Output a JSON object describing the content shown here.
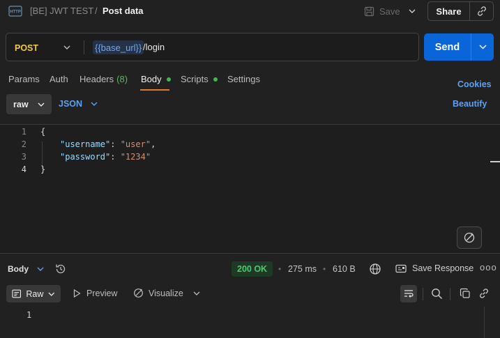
{
  "header": {
    "collection": "[BE] JWT TEST",
    "separator": "/",
    "request_name": "Post data",
    "save_label": "Save",
    "share_label": "Share"
  },
  "request": {
    "method": "POST",
    "url_variable": "{{base_url}}",
    "url_path": "/login",
    "send_label": "Send"
  },
  "tabs": [
    {
      "label": "Params"
    },
    {
      "label": "Auth"
    },
    {
      "label": "Headers",
      "count": "(8)"
    },
    {
      "label": "Body",
      "active": true
    },
    {
      "label": "Scripts"
    },
    {
      "label": "Settings"
    }
  ],
  "cookies_label": "Cookies",
  "body_mode": {
    "type": "raw",
    "format": "JSON",
    "beautify_label": "Beautify"
  },
  "editor": {
    "line_numbers": [
      "1",
      "2",
      "3",
      "4"
    ],
    "lines": [
      {
        "open": "{"
      },
      {
        "key": "\"username\"",
        "colon": ": ",
        "value": "\"user\"",
        "tail": ","
      },
      {
        "key": "\"password\"",
        "colon": ": ",
        "value": "\"1234\"",
        "tail": ""
      },
      {
        "close": "}"
      }
    ]
  },
  "response": {
    "view_label": "Body",
    "status": "200 OK",
    "time": "275 ms",
    "size": "610 B",
    "save_label": "Save Response",
    "more_label": "ooo",
    "format_label": "Raw",
    "preview_label": "Preview",
    "visualize_label": "Visualize",
    "line_number": "1"
  },
  "colors": {
    "accent": "#0a66d8",
    "method": "#f2c94c",
    "link": "#5ea1f0",
    "success": "#4cc96b",
    "tab_underline": "#e07a2f"
  }
}
